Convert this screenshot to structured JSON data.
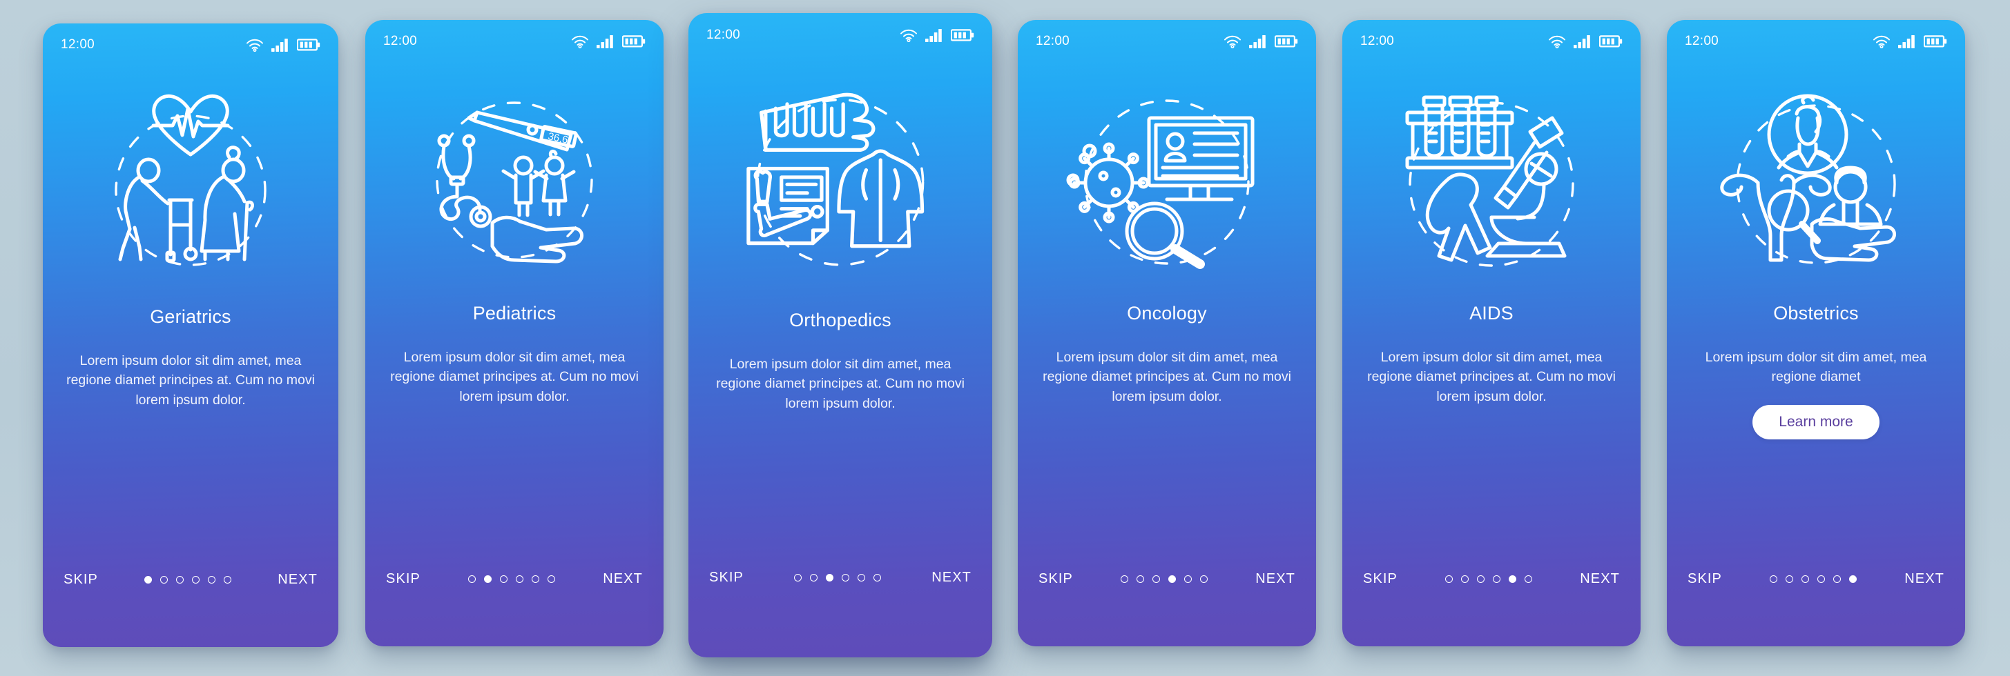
{
  "meta": {
    "background_color": "#bacfd9",
    "card_gradient_top": "#29b6f6",
    "card_gradient_mid": "#3d72d6",
    "card_gradient_bottom": "#5f4cb9",
    "cta_text_color": "#5a3f9e"
  },
  "status_bar": {
    "time": "12:00",
    "icons": [
      "wifi-icon",
      "signal-icon",
      "battery-icon"
    ]
  },
  "nav": {
    "skip_label": "SKIP",
    "next_label": "NEXT",
    "dot_count": 6
  },
  "screens": [
    {
      "id": "geriatrics",
      "title": "Geriatrics",
      "body": "Lorem ipsum dolor sit dim amet, mea regione diamet principes at. Cum no movi lorem ipsum dolor.",
      "illustration": "geriatrics-illustration",
      "active_dot": 0,
      "cta": null,
      "featured": false
    },
    {
      "id": "pediatrics",
      "title": "Pediatrics",
      "body": "Lorem ipsum dolor sit dim amet, mea regione diamet principes at. Cum no movi lorem ipsum dolor.",
      "illustration": "pediatrics-illustration",
      "thermometer_reading": "36,6",
      "active_dot": 1,
      "cta": null,
      "featured": false
    },
    {
      "id": "orthopedics",
      "title": "Orthopedics",
      "body": "Lorem ipsum dolor sit dim amet, mea regione diamet principes at. Cum no movi lorem ipsum dolor.",
      "illustration": "orthopedics-illustration",
      "active_dot": 2,
      "cta": null,
      "featured": true
    },
    {
      "id": "oncology",
      "title": "Oncology",
      "body": "Lorem ipsum dolor sit dim amet, mea regione diamet principes at. Cum no movi lorem ipsum dolor.",
      "illustration": "oncology-illustration",
      "active_dot": 3,
      "cta": null,
      "featured": false
    },
    {
      "id": "aids",
      "title": "AIDS",
      "body": "Lorem ipsum dolor sit dim amet, mea regione diamet principes at. Cum no movi lorem ipsum dolor.",
      "illustration": "aids-illustration",
      "active_dot": 4,
      "cta": null,
      "featured": false
    },
    {
      "id": "obstetrics",
      "title": "Obstetrics",
      "body": "Lorem ipsum dolor sit dim amet, mea regione diamet",
      "illustration": "obstetrics-illustration",
      "active_dot": 5,
      "cta": "Learn more",
      "featured": false
    }
  ]
}
